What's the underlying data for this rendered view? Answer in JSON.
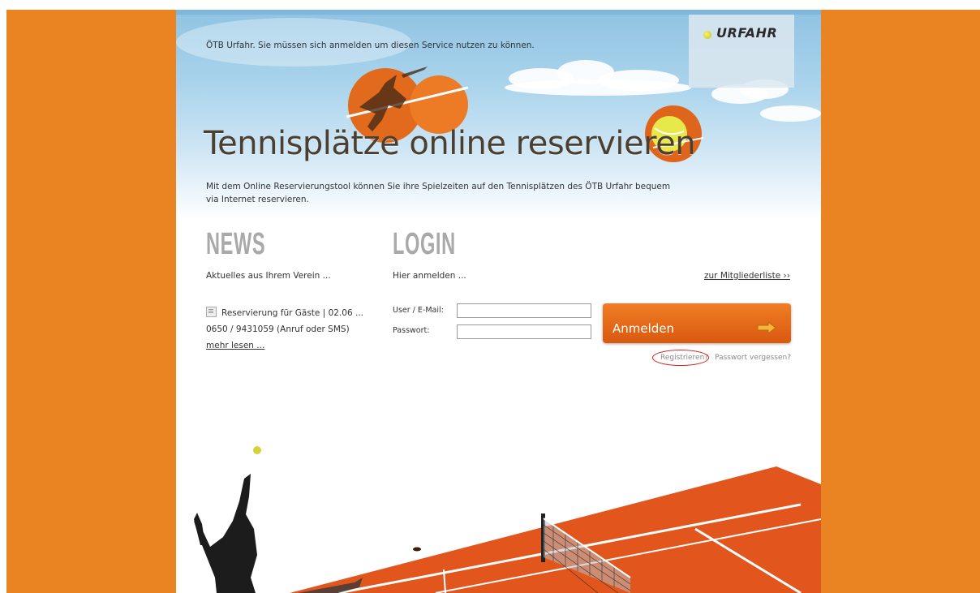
{
  "header": {
    "notice": "ÖTB Urfahr. Sie müssen sich anmelden um diesen Service nutzen zu können.",
    "logo_text": "URFAHR"
  },
  "hero": {
    "title": "Tennisplätze online reservieren",
    "intro": "Mit dem Online Reservierungstool können Sie ihre Spielzeiten auf den Tennisplätzen des ÖTB Urfahr bequem via Internet reservieren."
  },
  "news": {
    "heading": "NEWS",
    "subtitle": "Aktuelles aus Ihrem Verein ...",
    "item_title": "Reservierung für Gäste | 02.06 ...",
    "item_text": "0650 / 9431059 (Anruf oder SMS)",
    "more_link": "mehr lesen ..."
  },
  "login": {
    "heading": "LOGIN",
    "subtitle": "Hier anmelden ...",
    "member_list_link": "zur Mitgliederliste ››",
    "user_label": "User / E-Mail:",
    "user_value": "",
    "password_label": "Passwort:",
    "password_value": "",
    "submit_label": "Anmelden",
    "register_link": "Registrieren?",
    "forgot_link": "Passwort vergessen?"
  },
  "colors": {
    "background_orange": "#ea8423",
    "button_orange": "#e76a18",
    "court_orange": "#e2561e",
    "register_highlight": "#d01818"
  }
}
